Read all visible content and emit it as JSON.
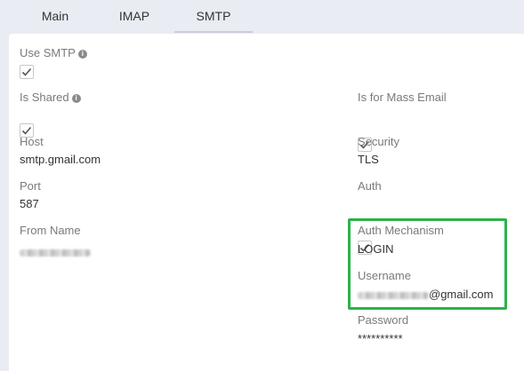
{
  "tabs": [
    {
      "label": "Main"
    },
    {
      "label": "IMAP"
    },
    {
      "label": "SMTP",
      "active": true
    }
  ],
  "fields": {
    "use_smtp": {
      "label": "Use SMTP",
      "checked": true
    },
    "is_shared": {
      "label": "Is Shared",
      "checked": true
    },
    "is_for_mass_email": {
      "label": "Is for Mass Email",
      "checked": true
    },
    "host": {
      "label": "Host",
      "value": "smtp.gmail.com"
    },
    "security": {
      "label": "Security",
      "value": "TLS"
    },
    "port": {
      "label": "Port",
      "value": "587"
    },
    "auth": {
      "label": "Auth",
      "checked": true
    },
    "from_name": {
      "label": "From Name"
    },
    "auth_mechanism": {
      "label": "Auth Mechanism",
      "value": "LOGIN"
    },
    "username": {
      "label": "Username",
      "value_suffix": "@gmail.com"
    },
    "password": {
      "label": "Password",
      "value": "**********"
    }
  },
  "colors": {
    "highlight": "#2db24a",
    "background": "#e9ecf3"
  },
  "icons": {
    "info": "info-icon",
    "check": "checkmark-icon"
  }
}
